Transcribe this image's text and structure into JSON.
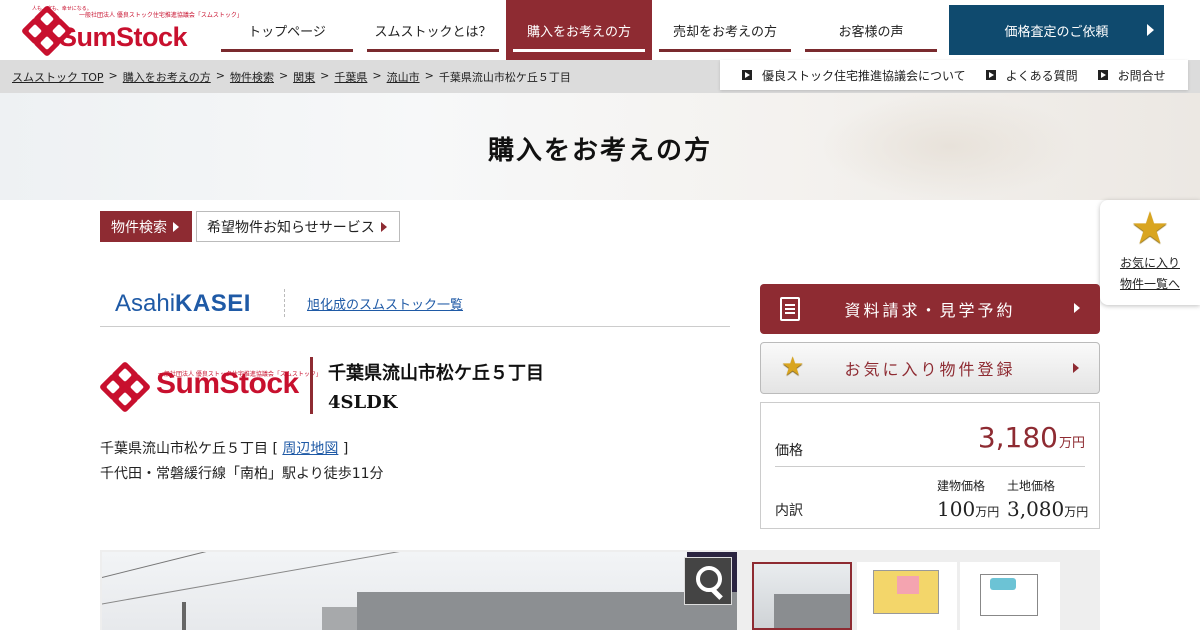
{
  "header": {
    "logo_text": "SumStock",
    "logo_tagline": "人も、家も、幸せになる。",
    "logo_org": "一般社団法人 優良ストック住宅推進協議会「スムストック」",
    "nav": [
      {
        "label": "トップページ",
        "active": false
      },
      {
        "label": "スムストックとは？",
        "active": false
      },
      {
        "label": "購入をお考えの方",
        "active": true
      },
      {
        "label": "売却をお考えの方",
        "active": false
      },
      {
        "label": "お客様の声",
        "active": false
      }
    ],
    "cta_label": "価格査定のご依頼"
  },
  "breadcrumb": {
    "items": [
      "スムストック TOP",
      "購入をお考えの方",
      "物件検索",
      "関東",
      "千葉県",
      "流山市"
    ],
    "current": "千葉県流山市松ケ丘５丁目",
    "separator": ">"
  },
  "sublinks": [
    "優良ストック住宅推進協議会について",
    "よくある質問",
    "お問合せ"
  ],
  "hero": {
    "title": "購入をお考えの方"
  },
  "tabs": [
    {
      "label": "物件検索",
      "active": true
    },
    {
      "label": "希望物件お知らせサービス",
      "active": false
    }
  ],
  "favorites_float": {
    "line1": "お気に入り",
    "line2": "物件一覧へ"
  },
  "maker": {
    "brand_a": "Asahi",
    "brand_b": "KASEI",
    "link": "旭化成のスムストック一覧"
  },
  "property": {
    "title": "千葉県流山市松ケ丘５丁目",
    "layout": "4SLDK",
    "address": "千葉県流山市松ケ丘５丁目",
    "map_link": "周辺地図",
    "access": "千代田・常磐緩行線「南柏」駅より徒歩11分"
  },
  "actions": {
    "request_label": "資料請求・見学予約",
    "favorite_label": "お気に入り物件登録"
  },
  "price": {
    "label": "価格",
    "value": "3,180",
    "unit": "万円",
    "breakdown_label": "内訳",
    "building_label": "建物価格",
    "building_value": "100",
    "land_label": "土地価格",
    "land_value": "3,080"
  },
  "colors": {
    "brand_red": "#8e2b32",
    "logo_red": "#c8102e",
    "navy": "#0f4a6e",
    "link_blue": "#1f5aa6"
  }
}
